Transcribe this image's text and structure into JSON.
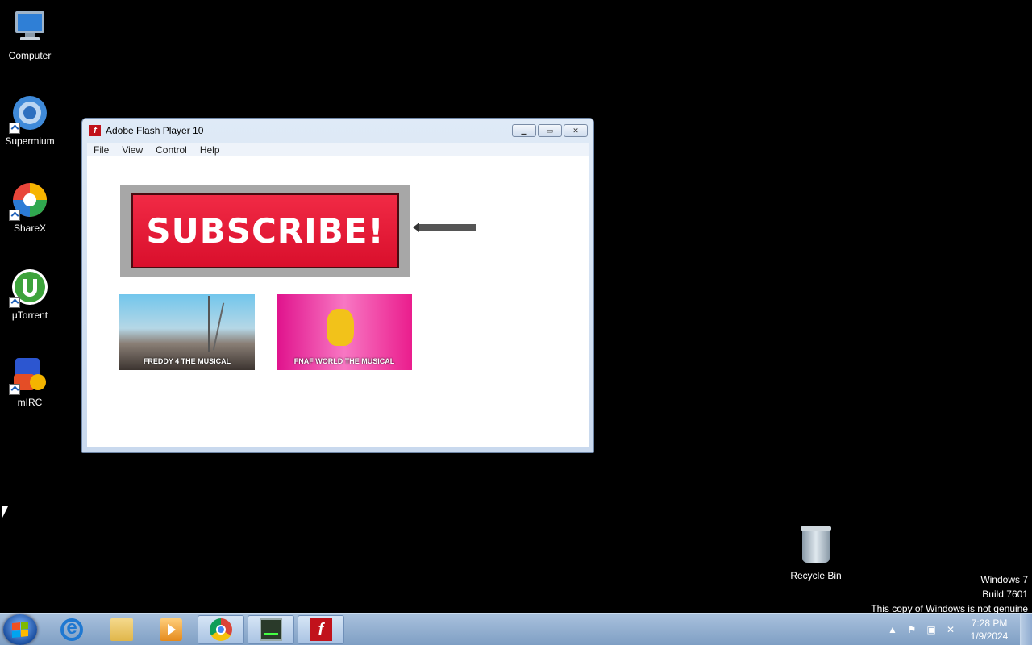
{
  "desktop": {
    "icons": [
      {
        "label": "Computer"
      },
      {
        "label": "Supermium"
      },
      {
        "label": "ShareX"
      },
      {
        "label": "μTorrent"
      },
      {
        "label": "mIRC"
      }
    ],
    "recycle_bin": {
      "label": "Recycle Bin"
    },
    "watermark": {
      "line1": "Windows 7",
      "line2": "Build 7601",
      "line3": "This copy of Windows is not genuine"
    }
  },
  "window": {
    "title": "Adobe Flash Player 10",
    "menu": [
      "File",
      "View",
      "Control",
      "Help"
    ],
    "content": {
      "subscribe_label": "SUBSCRIBE!",
      "thumbnails": [
        {
          "caption": "FREDDY 4 THE MUSICAL"
        },
        {
          "caption": "FNAF WORLD THE MUSICAL"
        }
      ]
    }
  },
  "taskbar": {
    "apps": [
      "internet-explorer",
      "file-explorer",
      "media-player",
      "chrome",
      "task-manager",
      "flash-player"
    ],
    "active_app": "flash-player",
    "clock": {
      "time": "7:28 PM",
      "date": "1/9/2024"
    }
  }
}
